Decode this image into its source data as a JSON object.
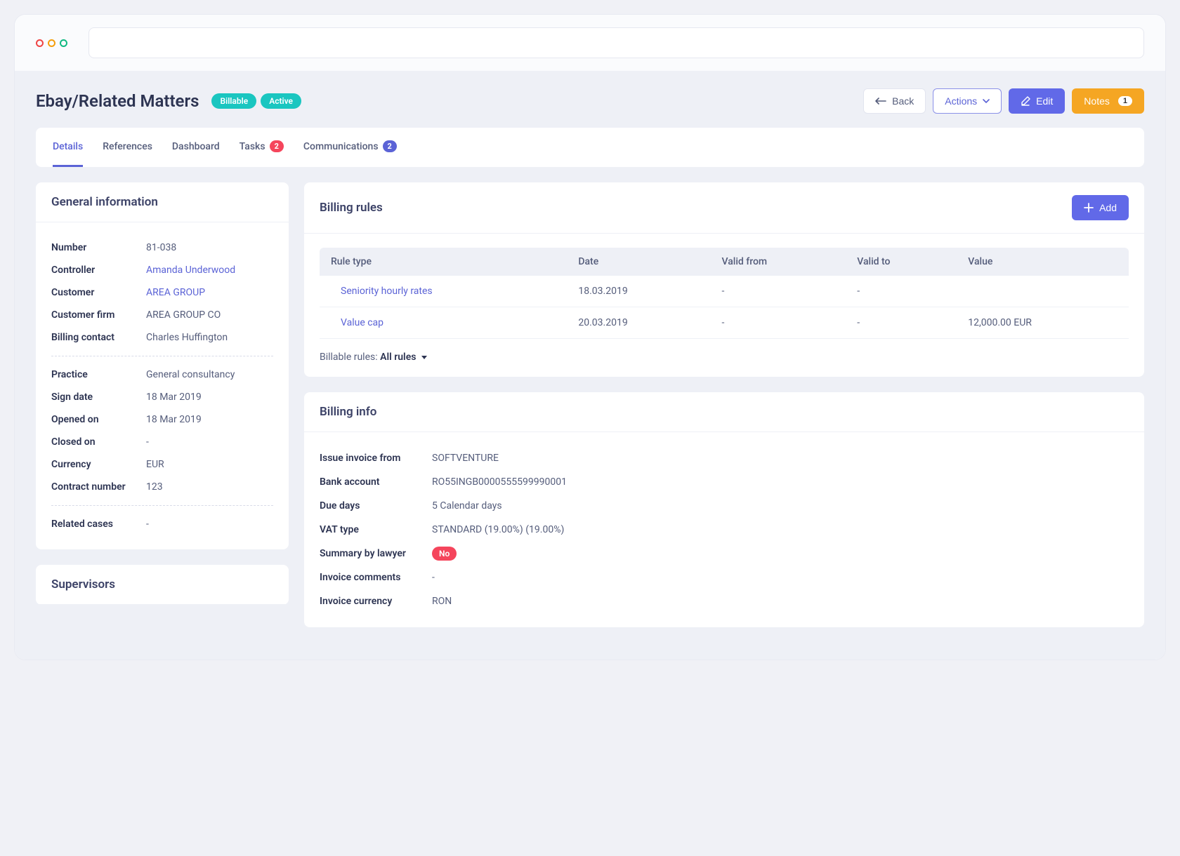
{
  "header": {
    "title": "Ebay/Related Matters",
    "badges": [
      {
        "text": "Billable"
      },
      {
        "text": "Active"
      }
    ],
    "back": "Back",
    "actions": "Actions",
    "edit": "Edit",
    "notes": "Notes",
    "notes_count": "1"
  },
  "tabs": [
    {
      "label": "Details",
      "badge": null
    },
    {
      "label": "References",
      "badge": null
    },
    {
      "label": "Dashboard",
      "badge": null
    },
    {
      "label": "Tasks",
      "badge": "2",
      "badgeColor": "pink"
    },
    {
      "label": "Communications",
      "badge": "2",
      "badgeColor": "blue"
    }
  ],
  "general": {
    "title": "General information",
    "rows1": [
      {
        "label": "Number",
        "value": "81-038"
      },
      {
        "label": "Controller",
        "value": "Amanda Underwood",
        "link": true
      },
      {
        "label": "Customer",
        "value": "AREA GROUP",
        "link": true
      },
      {
        "label": "Customer firm",
        "value": "AREA GROUP CO"
      },
      {
        "label": "Billing contact",
        "value": "Charles Huffington"
      }
    ],
    "rows2": [
      {
        "label": "Practice",
        "value": "General consultancy"
      },
      {
        "label": "Sign date",
        "value": "18 Mar 2019"
      },
      {
        "label": "Opened on",
        "value": "18 Mar 2019"
      },
      {
        "label": "Closed on",
        "value": "-"
      },
      {
        "label": "Currency",
        "value": "EUR"
      },
      {
        "label": "Contract number",
        "value": "123"
      }
    ],
    "rows3": [
      {
        "label": "Related cases",
        "value": "-"
      }
    ]
  },
  "supervisors": {
    "title": "Supervisors"
  },
  "billing_rules": {
    "title": "Billing rules",
    "add": "Add",
    "headers": [
      "Rule type",
      "Date",
      "Valid from",
      "Valid to",
      "Value"
    ],
    "rows": [
      {
        "type": "Seniority hourly rates",
        "date": "18.03.2019",
        "from": "-",
        "to": "-",
        "value": ""
      },
      {
        "type": "Value cap",
        "date": "20.03.2019",
        "from": "-",
        "to": "-",
        "value": "12,000.00 EUR"
      }
    ],
    "billable_label": "Billable rules:",
    "billable_value": "All rules"
  },
  "billing_info": {
    "title": "Billing info",
    "rows": [
      {
        "label": "Issue invoice from",
        "value": "SOFTVENTURE"
      },
      {
        "label": "Bank account",
        "value": "RO55INGB0000555599990001"
      },
      {
        "label": "Due days",
        "value": "5 Calendar days"
      },
      {
        "label": "VAT type",
        "value": "STANDARD (19.00%) (19.00%)"
      },
      {
        "label": "Summary by lawyer",
        "value": "No",
        "pill": true
      },
      {
        "label": "Invoice comments",
        "value": "-"
      },
      {
        "label": "Invoice currency",
        "value": "RON"
      }
    ]
  }
}
